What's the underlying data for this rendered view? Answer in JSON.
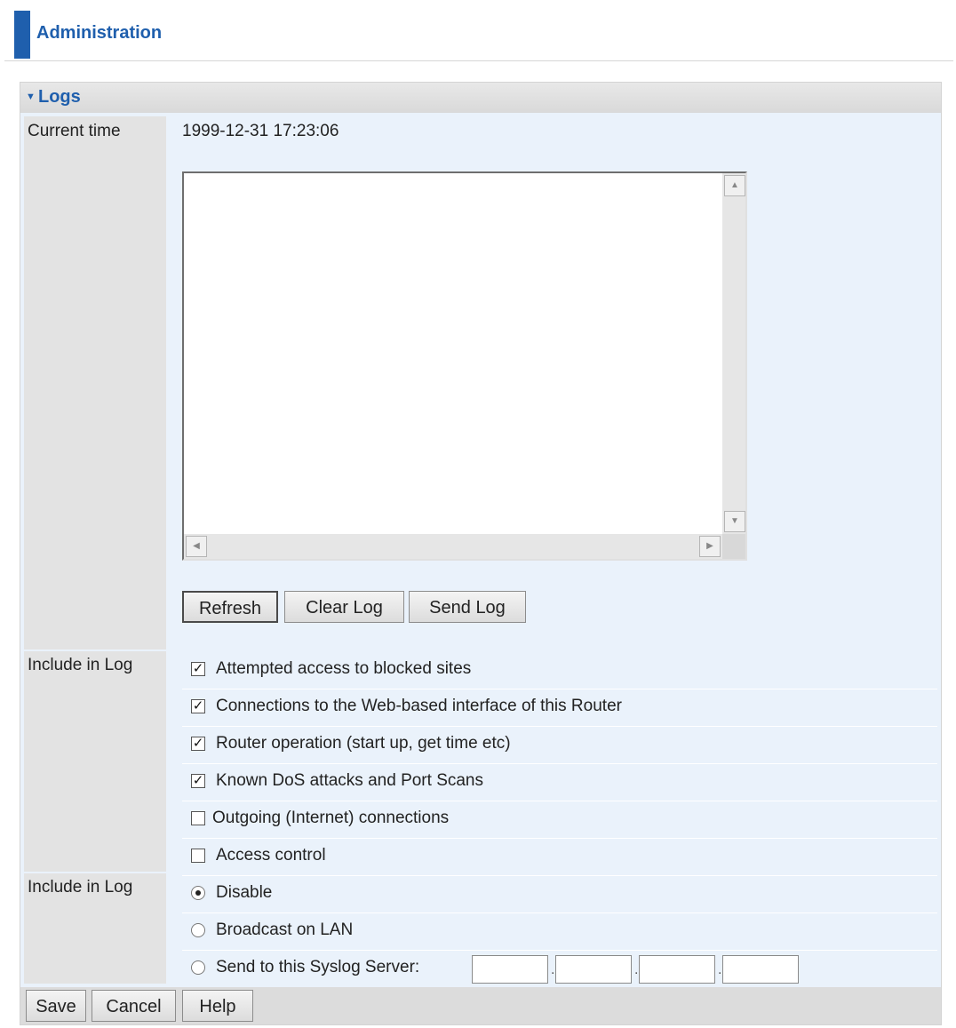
{
  "header": {
    "title": "Administration"
  },
  "section": {
    "title": "Logs"
  },
  "current_time": {
    "label": "Current time",
    "value": "1999-12-31 17:23:06"
  },
  "log_area": {
    "content": ""
  },
  "log_buttons": {
    "refresh": "Refresh",
    "clear": "Clear Log",
    "send": "Send Log"
  },
  "include_log": {
    "label": "Include in Log",
    "options": [
      {
        "label": "Attempted access to blocked sites",
        "checked": true
      },
      {
        "label": "Connections to the Web-based interface of this Router",
        "checked": true
      },
      {
        "label": "Router operation (start up, get time etc)",
        "checked": true
      },
      {
        "label": "Known DoS attacks and Port Scans",
        "checked": true
      },
      {
        "label": "Outgoing (Internet) connections",
        "checked": false
      },
      {
        "label": "Access control",
        "checked": false
      }
    ]
  },
  "syslog": {
    "label": "Include in Log",
    "options": [
      {
        "label": "Disable",
        "selected": true
      },
      {
        "label": "Broadcast on LAN",
        "selected": false
      },
      {
        "label": "Send to this Syslog Server:",
        "selected": false
      }
    ],
    "ip_octets": [
      "",
      "",
      "",
      ""
    ]
  },
  "footer": {
    "save": "Save",
    "cancel": "Cancel",
    "help": "Help"
  },
  "colors": {
    "accent": "#1f5fad",
    "panel_bg": "#eaf2fb",
    "label_bg": "#e3e3e3"
  }
}
